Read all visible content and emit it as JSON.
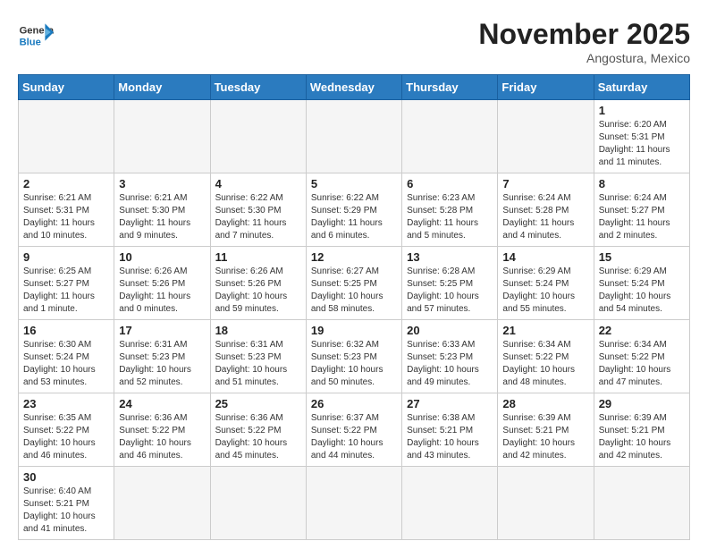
{
  "header": {
    "logo_general": "General",
    "logo_blue": "Blue",
    "month_title": "November 2025",
    "location": "Angostura, Mexico"
  },
  "days_of_week": [
    "Sunday",
    "Monday",
    "Tuesday",
    "Wednesday",
    "Thursday",
    "Friday",
    "Saturday"
  ],
  "weeks": [
    [
      {
        "day": "",
        "info": ""
      },
      {
        "day": "",
        "info": ""
      },
      {
        "day": "",
        "info": ""
      },
      {
        "day": "",
        "info": ""
      },
      {
        "day": "",
        "info": ""
      },
      {
        "day": "",
        "info": ""
      },
      {
        "day": "1",
        "info": "Sunrise: 6:20 AM\nSunset: 5:31 PM\nDaylight: 11 hours and 11 minutes."
      }
    ],
    [
      {
        "day": "2",
        "info": "Sunrise: 6:21 AM\nSunset: 5:31 PM\nDaylight: 11 hours and 10 minutes."
      },
      {
        "day": "3",
        "info": "Sunrise: 6:21 AM\nSunset: 5:30 PM\nDaylight: 11 hours and 9 minutes."
      },
      {
        "day": "4",
        "info": "Sunrise: 6:22 AM\nSunset: 5:30 PM\nDaylight: 11 hours and 7 minutes."
      },
      {
        "day": "5",
        "info": "Sunrise: 6:22 AM\nSunset: 5:29 PM\nDaylight: 11 hours and 6 minutes."
      },
      {
        "day": "6",
        "info": "Sunrise: 6:23 AM\nSunset: 5:28 PM\nDaylight: 11 hours and 5 minutes."
      },
      {
        "day": "7",
        "info": "Sunrise: 6:24 AM\nSunset: 5:28 PM\nDaylight: 11 hours and 4 minutes."
      },
      {
        "day": "8",
        "info": "Sunrise: 6:24 AM\nSunset: 5:27 PM\nDaylight: 11 hours and 2 minutes."
      }
    ],
    [
      {
        "day": "9",
        "info": "Sunrise: 6:25 AM\nSunset: 5:27 PM\nDaylight: 11 hours and 1 minute."
      },
      {
        "day": "10",
        "info": "Sunrise: 6:26 AM\nSunset: 5:26 PM\nDaylight: 11 hours and 0 minutes."
      },
      {
        "day": "11",
        "info": "Sunrise: 6:26 AM\nSunset: 5:26 PM\nDaylight: 10 hours and 59 minutes."
      },
      {
        "day": "12",
        "info": "Sunrise: 6:27 AM\nSunset: 5:25 PM\nDaylight: 10 hours and 58 minutes."
      },
      {
        "day": "13",
        "info": "Sunrise: 6:28 AM\nSunset: 5:25 PM\nDaylight: 10 hours and 57 minutes."
      },
      {
        "day": "14",
        "info": "Sunrise: 6:29 AM\nSunset: 5:24 PM\nDaylight: 10 hours and 55 minutes."
      },
      {
        "day": "15",
        "info": "Sunrise: 6:29 AM\nSunset: 5:24 PM\nDaylight: 10 hours and 54 minutes."
      }
    ],
    [
      {
        "day": "16",
        "info": "Sunrise: 6:30 AM\nSunset: 5:24 PM\nDaylight: 10 hours and 53 minutes."
      },
      {
        "day": "17",
        "info": "Sunrise: 6:31 AM\nSunset: 5:23 PM\nDaylight: 10 hours and 52 minutes."
      },
      {
        "day": "18",
        "info": "Sunrise: 6:31 AM\nSunset: 5:23 PM\nDaylight: 10 hours and 51 minutes."
      },
      {
        "day": "19",
        "info": "Sunrise: 6:32 AM\nSunset: 5:23 PM\nDaylight: 10 hours and 50 minutes."
      },
      {
        "day": "20",
        "info": "Sunrise: 6:33 AM\nSunset: 5:23 PM\nDaylight: 10 hours and 49 minutes."
      },
      {
        "day": "21",
        "info": "Sunrise: 6:34 AM\nSunset: 5:22 PM\nDaylight: 10 hours and 48 minutes."
      },
      {
        "day": "22",
        "info": "Sunrise: 6:34 AM\nSunset: 5:22 PM\nDaylight: 10 hours and 47 minutes."
      }
    ],
    [
      {
        "day": "23",
        "info": "Sunrise: 6:35 AM\nSunset: 5:22 PM\nDaylight: 10 hours and 46 minutes."
      },
      {
        "day": "24",
        "info": "Sunrise: 6:36 AM\nSunset: 5:22 PM\nDaylight: 10 hours and 46 minutes."
      },
      {
        "day": "25",
        "info": "Sunrise: 6:36 AM\nSunset: 5:22 PM\nDaylight: 10 hours and 45 minutes."
      },
      {
        "day": "26",
        "info": "Sunrise: 6:37 AM\nSunset: 5:22 PM\nDaylight: 10 hours and 44 minutes."
      },
      {
        "day": "27",
        "info": "Sunrise: 6:38 AM\nSunset: 5:21 PM\nDaylight: 10 hours and 43 minutes."
      },
      {
        "day": "28",
        "info": "Sunrise: 6:39 AM\nSunset: 5:21 PM\nDaylight: 10 hours and 42 minutes."
      },
      {
        "day": "29",
        "info": "Sunrise: 6:39 AM\nSunset: 5:21 PM\nDaylight: 10 hours and 42 minutes."
      }
    ],
    [
      {
        "day": "30",
        "info": "Sunrise: 6:40 AM\nSunset: 5:21 PM\nDaylight: 10 hours and 41 minutes."
      },
      {
        "day": "",
        "info": ""
      },
      {
        "day": "",
        "info": ""
      },
      {
        "day": "",
        "info": ""
      },
      {
        "day": "",
        "info": ""
      },
      {
        "day": "",
        "info": ""
      },
      {
        "day": "",
        "info": ""
      }
    ]
  ]
}
